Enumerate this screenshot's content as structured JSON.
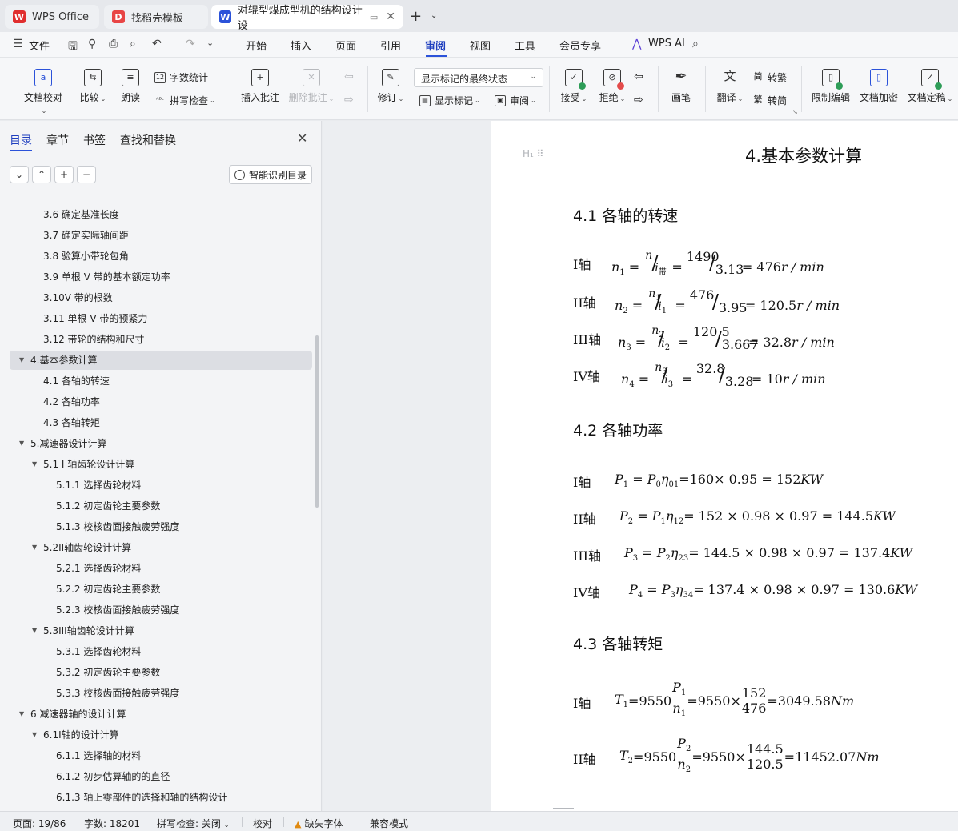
{
  "tabs": [
    {
      "label": "WPS Office",
      "logo": "W",
      "color": "#e02e2e"
    },
    {
      "label": "找稻壳模板",
      "logo": "D",
      "color": "#e84545"
    },
    {
      "label": "对辊型煤成型机的结构设计 设",
      "logo": "W",
      "color": "#2b52d9"
    }
  ],
  "menubar": {
    "file": "文件",
    "items": [
      "开始",
      "插入",
      "页面",
      "引用",
      "审阅",
      "视图",
      "工具",
      "会员专享"
    ],
    "active": "审阅",
    "wps_ai": "WPS AI"
  },
  "ribbon": {
    "doc_check": "文档校对",
    "compare": "比较",
    "read": "朗读",
    "word_count": "字数统计",
    "spell_check": "拼写检查",
    "insert_comment": "插入批注",
    "delete_comment": "删除批注",
    "revise": "修订",
    "markup_state": "显示标记的最终状态",
    "show_markup": "显示标记",
    "review": "审阅",
    "accept": "接受",
    "reject": "拒绝",
    "pen": "画笔",
    "translate": "翻译",
    "to_traditional": "转繁",
    "to_simplified": "转简",
    "restrict_edit": "限制编辑",
    "encrypt": "文档加密",
    "finalize": "文档定稿"
  },
  "nav": {
    "tabs": [
      "目录",
      "章节",
      "书签",
      "查找和替换"
    ],
    "smart_btn": "智能识别目录",
    "toc": [
      {
        "label": "3.6 确定基准长度",
        "indent": 2,
        "arrow": false
      },
      {
        "label": "3.7 确定实际轴间距",
        "indent": 2,
        "arrow": false
      },
      {
        "label": "3.8 验算小带轮包角",
        "indent": 2,
        "arrow": false
      },
      {
        "label": "3.9 单根 V 带的基本额定功率",
        "indent": 2,
        "arrow": false
      },
      {
        "label": "3.10V 带的根数",
        "indent": 2,
        "arrow": false
      },
      {
        "label": "3.11 单根 V 带的预紧力",
        "indent": 2,
        "arrow": false
      },
      {
        "label": "3.12 带轮的结构和尺寸",
        "indent": 2,
        "arrow": false
      },
      {
        "label": "4.基本参数计算",
        "indent": 1,
        "arrow": true,
        "selected": true
      },
      {
        "label": "4.1 各轴的转速",
        "indent": 2,
        "arrow": false
      },
      {
        "label": "4.2 各轴功率",
        "indent": 2,
        "arrow": false
      },
      {
        "label": "4.3 各轴转矩",
        "indent": 2,
        "arrow": false
      },
      {
        "label": "5.减速器设计计算",
        "indent": 1,
        "arrow": true
      },
      {
        "label": "5.1 I 轴齿轮设计计算",
        "indent": 2,
        "arrow": true
      },
      {
        "label": "5.1.1 选择齿轮材料",
        "indent": 3,
        "arrow": false
      },
      {
        "label": "5.1.2 初定齿轮主要参数",
        "indent": 3,
        "arrow": false
      },
      {
        "label": "5.1.3 校核齿面接触疲劳强度",
        "indent": 3,
        "arrow": false
      },
      {
        "label": "5.2II轴齿轮设计计算",
        "indent": 2,
        "arrow": true
      },
      {
        "label": "5.2.1 选择齿轮材料",
        "indent": 3,
        "arrow": false
      },
      {
        "label": "5.2.2  初定齿轮主要参数",
        "indent": 3,
        "arrow": false
      },
      {
        "label": "5.2.3 校核齿面接触疲劳强度",
        "indent": 3,
        "arrow": false
      },
      {
        "label": "5.3III轴齿轮设计计算",
        "indent": 2,
        "arrow": true
      },
      {
        "label": "5.3.1 选择齿轮材料",
        "indent": 3,
        "arrow": false
      },
      {
        "label": "5.3.2  初定齿轮主要参数",
        "indent": 3,
        "arrow": false
      },
      {
        "label": "5.3.3  校核齿面接触疲劳强度",
        "indent": 3,
        "arrow": false
      },
      {
        "label": "6  减速器轴的设计计算",
        "indent": 1,
        "arrow": true
      },
      {
        "label": "6.1I轴的设计计算",
        "indent": 2,
        "arrow": true
      },
      {
        "label": "6.1.1 选择轴的材料",
        "indent": 3,
        "arrow": false
      },
      {
        "label": "6.1.2 初步估算轴的的直径",
        "indent": 3,
        "arrow": false
      },
      {
        "label": "6.1.3 轴上零部件的选择和轴的结构设计",
        "indent": 3,
        "arrow": false
      }
    ]
  },
  "doc": {
    "h1": "4.基本参数计算",
    "s41": "4.1 各轴的转速",
    "s42": "4.2 各轴功率",
    "s43": "4.3 各轴转矩",
    "speed": [
      {
        "axis": "I轴",
        "var": "n",
        "sub": "1",
        "num": "n",
        "den": "i",
        "den_sub": "带",
        "v1": "1490",
        "v2": "3.13",
        "res": "476",
        "unit": "r / min"
      },
      {
        "axis": "II轴",
        "var": "n",
        "sub": "2",
        "num": "n",
        "num_sub": "1",
        "den": "i",
        "den_sub": "1",
        "v1": "476",
        "v2": "3.95",
        "res": "120.5",
        "unit": "r / min"
      },
      {
        "axis": "III轴",
        "var": "n",
        "sub": "3",
        "num": "n",
        "num_sub": "2",
        "den": "i",
        "den_sub": "2",
        "v1": "120.5",
        "v2": "3.667",
        "res": "32.8",
        "unit": "r / min"
      },
      {
        "axis": "IV轴",
        "var": "n",
        "sub": "4",
        "num": "n",
        "num_sub": "3",
        "den": "i",
        "den_sub": "3",
        "v1": "32.8",
        "v2": "3.28",
        "res": "10",
        "unit": "r / min"
      }
    ],
    "power": [
      {
        "axis": "I轴",
        "lhs": "P",
        "sub": "1",
        "expr": "P",
        "expr_sub": "0",
        "eta": "η",
        "eta_sub": "01",
        "calc": "=160× 0.95 = 152",
        "unit": "KW"
      },
      {
        "axis": "II轴",
        "lhs": "P",
        "sub": "2",
        "expr": "P",
        "expr_sub": "1",
        "eta": "η",
        "eta_sub": "12",
        "calc": "= 152 × 0.98 × 0.97 = 144.5",
        "unit": "KW"
      },
      {
        "axis": "III轴",
        "lhs": "P",
        "sub": "3",
        "expr": "P",
        "expr_sub": "2",
        "eta": "η",
        "eta_sub": "23",
        "calc": "= 144.5 × 0.98 × 0.97 = 137.4",
        "unit": "KW"
      },
      {
        "axis": "IV轴",
        "lhs": "P",
        "sub": "4",
        "expr": "P",
        "expr_sub": "3",
        "eta": "η",
        "eta_sub": "34",
        "calc": "= 137.4 × 0.98 × 0.97 = 130.6",
        "unit": "KW"
      }
    ],
    "torque": [
      {
        "axis": "I轴",
        "lhs": "T",
        "sub": "1",
        "k": "9550",
        "fp": "P",
        "fp_sub": "1",
        "fn": "n",
        "fn_sub": "1",
        "num": "152",
        "den": "476",
        "res": "3049.58",
        "unit": "Nm"
      },
      {
        "axis": "II轴",
        "lhs": "T",
        "sub": "2",
        "k": "9550",
        "fp": "P",
        "fp_sub": "2",
        "fn": "n",
        "fn_sub": "2",
        "num": "144.5",
        "den": "120.5",
        "res": "11452.07",
        "unit": "Nm"
      }
    ]
  },
  "status": {
    "page": "页面: 19/86",
    "words": "字数: 18201",
    "spell": "拼写检查: 关闭",
    "proof": "校对",
    "missing_font": "缺失字体",
    "compat": "兼容模式"
  }
}
